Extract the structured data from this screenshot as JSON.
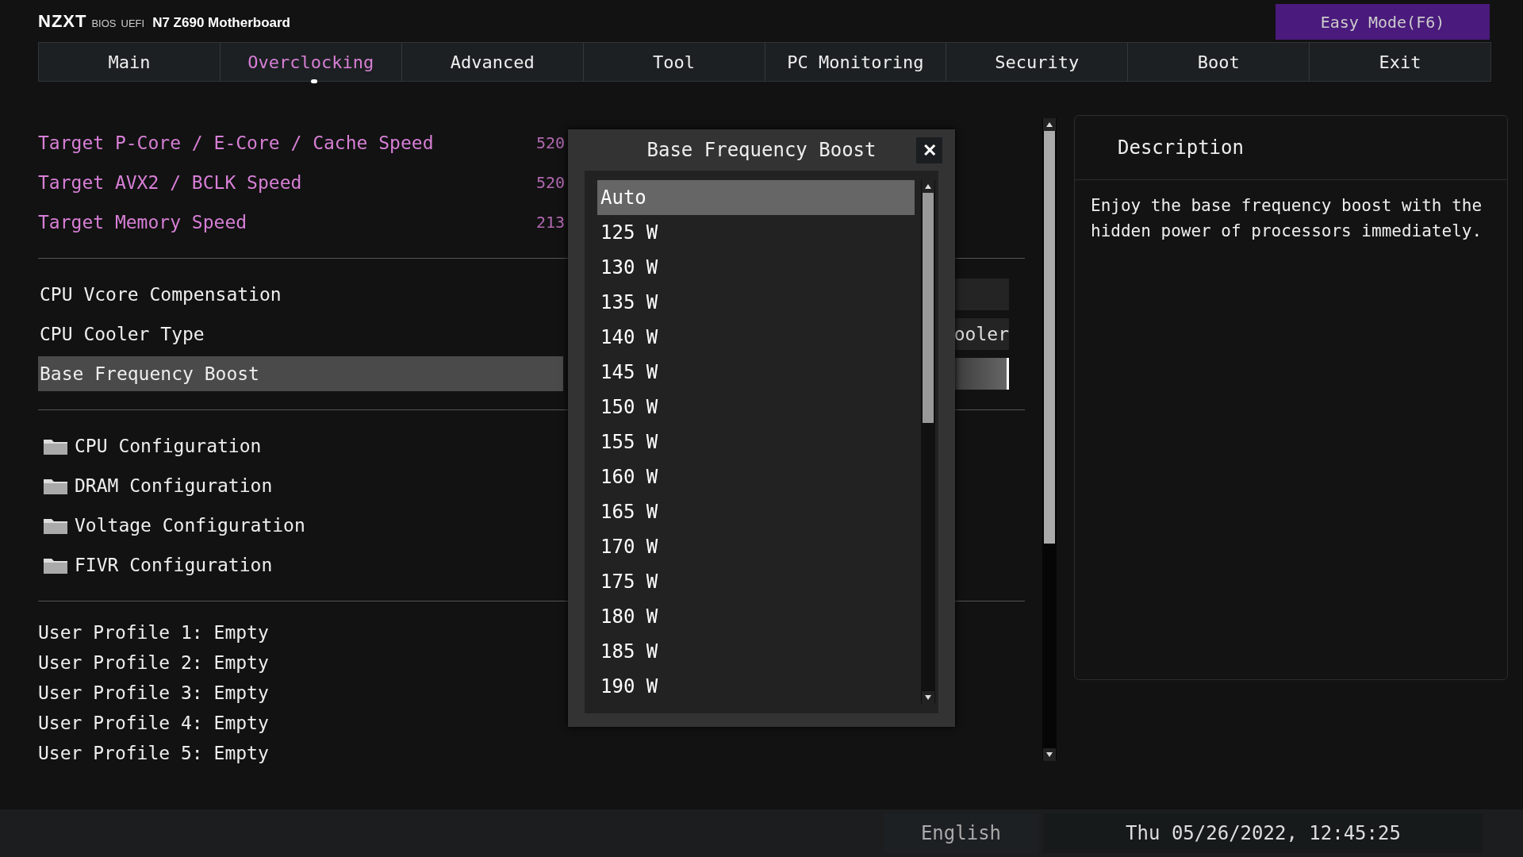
{
  "header": {
    "brand": "NZXT",
    "bios": "BIOS",
    "uefi": "UEFI",
    "model": "N7 Z690 Motherboard",
    "easy_mode": "Easy Mode(F6)"
  },
  "tabs": [
    {
      "label": "Main",
      "selected": false
    },
    {
      "label": "Overclocking",
      "selected": true
    },
    {
      "label": "Advanced",
      "selected": false
    },
    {
      "label": "Tool",
      "selected": false
    },
    {
      "label": "PC Monitoring",
      "selected": false
    },
    {
      "label": "Security",
      "selected": false
    },
    {
      "label": "Boot",
      "selected": false
    },
    {
      "label": "Exit",
      "selected": false
    }
  ],
  "targets": [
    {
      "label": "Target P-Core / E-Core / Cache Speed",
      "value": "520"
    },
    {
      "label": "Target AVX2 / BCLK Speed",
      "value": "520"
    },
    {
      "label": "Target Memory Speed",
      "value": "213"
    }
  ],
  "settings": [
    {
      "label": "CPU Vcore Compensation",
      "selected": false
    },
    {
      "label": "CPU Cooler Type",
      "selected": false,
      "value": "ooler"
    },
    {
      "label": "Base Frequency Boost",
      "selected": true
    }
  ],
  "submenus": [
    "CPU Configuration",
    "DRAM Configuration",
    "Voltage Configuration",
    "FIVR Configuration"
  ],
  "profiles": [
    "User Profile 1: Empty",
    "User Profile 2: Empty",
    "User Profile 3: Empty",
    "User Profile 4: Empty",
    "User Profile 5: Empty"
  ],
  "dialog": {
    "title": "Base Frequency Boost",
    "close": "✕",
    "options": [
      {
        "label": "Auto",
        "selected": true
      },
      {
        "label": "125 W",
        "selected": false
      },
      {
        "label": "130 W",
        "selected": false
      },
      {
        "label": "135 W",
        "selected": false
      },
      {
        "label": "140 W",
        "selected": false
      },
      {
        "label": "145 W",
        "selected": false
      },
      {
        "label": "150 W",
        "selected": false
      },
      {
        "label": "155 W",
        "selected": false
      },
      {
        "label": "160 W",
        "selected": false
      },
      {
        "label": "165 W",
        "selected": false
      },
      {
        "label": "170 W",
        "selected": false
      },
      {
        "label": "175 W",
        "selected": false
      },
      {
        "label": "180 W",
        "selected": false
      },
      {
        "label": "185 W",
        "selected": false
      },
      {
        "label": "190 W",
        "selected": false
      }
    ]
  },
  "description": {
    "title": "Description",
    "text": "Enjoy the base frequency boost with the hidden power of processors immediately."
  },
  "status": {
    "language": "English",
    "datetime": "Thu 05/26/2022, 12:45:25"
  }
}
